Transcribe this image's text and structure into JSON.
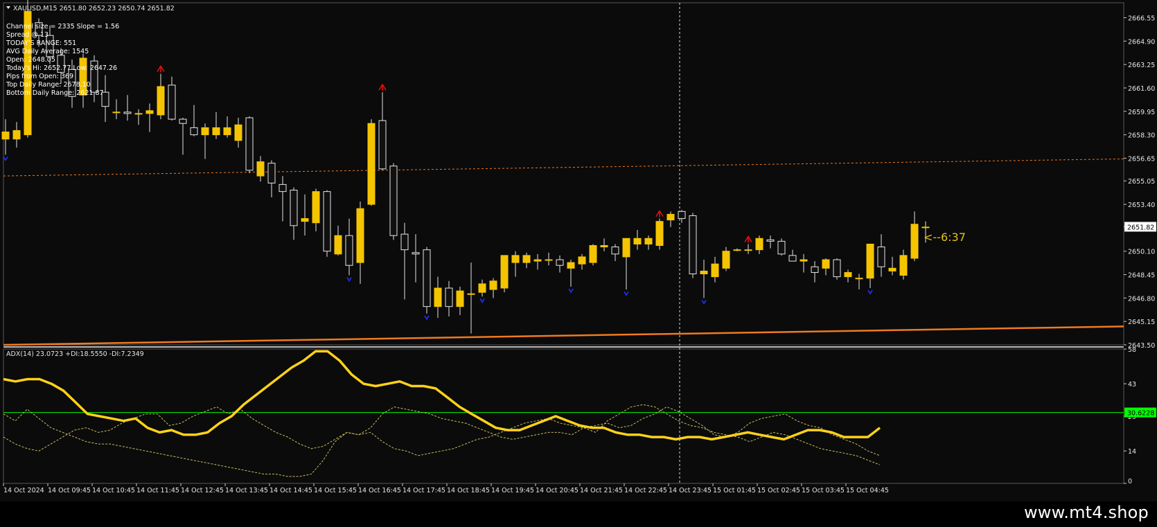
{
  "window": {
    "symbol_header": "XAUUSD,M15  2651.80 2652.23 2650.74 2651.82",
    "brand": "www.mt4.shop"
  },
  "info_lines": [
    "Channel size = 2335 Slope = 1.56",
    "Spread @ 13",
    "TODAY'S RANGE: 551",
    "AVG Daily Average: 1545",
    "Open: 2648.05",
    "Today's Hi: 2652.77  Low: 2647.26",
    "Pips from Open: 369",
    "Top Daily Range: 2678.10",
    "Bottom Daily Range: 2621.87"
  ],
  "countdown": "<--6:37",
  "price_axis": {
    "ticks": [
      "2666.55",
      "2664.90",
      "2663.25",
      "2661.60",
      "2659.95",
      "2658.30",
      "2656.65",
      "2655.05",
      "2653.40",
      "2651.82",
      "2650.10",
      "2648.45",
      "2646.80",
      "2645.15",
      "2643.50"
    ],
    "current_label": "2651.82"
  },
  "adx": {
    "label": "ADX(14) 23.0723 +DI:18.5550 -DI:7.2349",
    "ticks": [
      "58",
      "43",
      "29",
      "14",
      "0"
    ],
    "level_label": "30.6228",
    "level_color": "#00ff00"
  },
  "time_axis": [
    "14 Oct 2024",
    "14 Oct 09:45",
    "14 Oct 10:45",
    "14 Oct 11:45",
    "14 Oct 12:45",
    "14 Oct 13:45",
    "14 Oct 14:45",
    "14 Oct 15:45",
    "14 Oct 16:45",
    "14 Oct 17:45",
    "14 Oct 18:45",
    "14 Oct 19:45",
    "14 Oct 20:45",
    "14 Oct 21:45",
    "14 Oct 22:45",
    "14 Oct 23:45",
    "15 Oct 01:45",
    "15 Oct 02:45",
    "15 Oct 03:45",
    "15 Oct 04:45"
  ],
  "colors": {
    "background": "#0b0b0b",
    "bull_candle": "#f5c400",
    "bear_candle": "#101010",
    "candle_outline": "#e6e6e6",
    "channel": "#f07a20",
    "adx_line": "#ffd21a",
    "di_line": "#c8c060",
    "arrow_up": "#e01010",
    "arrow_down": "#2030ff",
    "countdown": "#e6c21a",
    "axis_text": "#e6e6e6"
  },
  "chart_data": {
    "type": "candlestick",
    "price_range": [
      2643.5,
      2667.6
    ],
    "candles": [
      {
        "o": 2658.0,
        "h": 2659.4,
        "l": 2656.9,
        "c": 2658.5
      },
      {
        "o": 2658.0,
        "h": 2659.2,
        "l": 2657.4,
        "c": 2658.6
      },
      {
        "o": 2658.3,
        "h": 2668.1,
        "l": 2658.1,
        "c": 2667.0
      },
      {
        "o": 2666.2,
        "h": 2666.5,
        "l": 2664.5,
        "c": 2665.3
      },
      {
        "o": 2665.3,
        "h": 2666.0,
        "l": 2663.3,
        "c": 2663.8
      },
      {
        "o": 2663.9,
        "h": 2664.4,
        "l": 2661.9,
        "c": 2662.7
      },
      {
        "o": 2662.9,
        "h": 2663.6,
        "l": 2660.2,
        "c": 2661.0
      },
      {
        "o": 2661.1,
        "h": 2664.0,
        "l": 2660.2,
        "c": 2663.7
      },
      {
        "o": 2663.5,
        "h": 2663.9,
        "l": 2660.6,
        "c": 2661.3
      },
      {
        "o": 2661.3,
        "h": 2662.5,
        "l": 2659.2,
        "c": 2660.3
      },
      {
        "o": 2659.9,
        "h": 2660.8,
        "l": 2659.4,
        "c": 2659.9
      },
      {
        "o": 2659.9,
        "h": 2661.1,
        "l": 2659.3,
        "c": 2659.8
      },
      {
        "o": 2659.8,
        "h": 2660.1,
        "l": 2659.0,
        "c": 2659.8
      },
      {
        "o": 2659.8,
        "h": 2660.5,
        "l": 2658.5,
        "c": 2660.0
      },
      {
        "o": 2659.7,
        "h": 2662.6,
        "l": 2659.4,
        "c": 2661.7
      },
      {
        "o": 2661.8,
        "h": 2662.4,
        "l": 2659.3,
        "c": 2659.4
      },
      {
        "o": 2659.4,
        "h": 2659.5,
        "l": 2656.9,
        "c": 2659.1
      },
      {
        "o": 2658.8,
        "h": 2660.4,
        "l": 2658.2,
        "c": 2658.3
      },
      {
        "o": 2658.3,
        "h": 2659.1,
        "l": 2656.6,
        "c": 2658.8
      },
      {
        "o": 2658.3,
        "h": 2659.9,
        "l": 2658.0,
        "c": 2658.8
      },
      {
        "o": 2658.3,
        "h": 2659.6,
        "l": 2658.1,
        "c": 2658.8
      },
      {
        "o": 2657.9,
        "h": 2659.5,
        "l": 2657.4,
        "c": 2659.0
      },
      {
        "o": 2659.5,
        "h": 2659.6,
        "l": 2655.6,
        "c": 2655.8
      },
      {
        "o": 2655.4,
        "h": 2656.8,
        "l": 2655.0,
        "c": 2656.4
      },
      {
        "o": 2656.3,
        "h": 2656.5,
        "l": 2653.9,
        "c": 2654.9
      },
      {
        "o": 2654.8,
        "h": 2655.4,
        "l": 2652.2,
        "c": 2654.3
      },
      {
        "o": 2654.4,
        "h": 2654.6,
        "l": 2650.9,
        "c": 2651.9
      },
      {
        "o": 2652.2,
        "h": 2654.1,
        "l": 2651.2,
        "c": 2652.4
      },
      {
        "o": 2652.1,
        "h": 2654.5,
        "l": 2651.5,
        "c": 2654.3
      },
      {
        "o": 2654.3,
        "h": 2654.4,
        "l": 2649.7,
        "c": 2650.1
      },
      {
        "o": 2649.9,
        "h": 2651.9,
        "l": 2649.8,
        "c": 2651.2
      },
      {
        "o": 2651.2,
        "h": 2652.4,
        "l": 2648.4,
        "c": 2649.1
      },
      {
        "o": 2649.3,
        "h": 2653.6,
        "l": 2647.8,
        "c": 2653.1
      },
      {
        "o": 2653.4,
        "h": 2659.4,
        "l": 2653.3,
        "c": 2659.1
      },
      {
        "o": 2659.3,
        "h": 2661.3,
        "l": 2655.8,
        "c": 2655.9
      },
      {
        "o": 2656.1,
        "h": 2656.3,
        "l": 2650.9,
        "c": 2651.2
      },
      {
        "o": 2651.3,
        "h": 2652.1,
        "l": 2646.7,
        "c": 2650.2
      },
      {
        "o": 2650.0,
        "h": 2651.3,
        "l": 2647.9,
        "c": 2649.9
      },
      {
        "o": 2650.2,
        "h": 2650.4,
        "l": 2645.7,
        "c": 2646.2
      },
      {
        "o": 2646.2,
        "h": 2648.3,
        "l": 2645.4,
        "c": 2647.5
      },
      {
        "o": 2647.5,
        "h": 2648.0,
        "l": 2645.5,
        "c": 2646.2
      },
      {
        "o": 2646.2,
        "h": 2647.6,
        "l": 2645.6,
        "c": 2647.3
      },
      {
        "o": 2647.1,
        "h": 2649.3,
        "l": 2644.3,
        "c": 2647.1
      },
      {
        "o": 2647.2,
        "h": 2648.1,
        "l": 2646.9,
        "c": 2647.8
      },
      {
        "o": 2647.4,
        "h": 2648.2,
        "l": 2646.8,
        "c": 2648.0
      },
      {
        "o": 2647.5,
        "h": 2649.1,
        "l": 2647.2,
        "c": 2649.8
      },
      {
        "o": 2649.3,
        "h": 2650.1,
        "l": 2648.3,
        "c": 2649.8
      },
      {
        "o": 2649.3,
        "h": 2650.0,
        "l": 2648.9,
        "c": 2649.8
      },
      {
        "o": 2649.4,
        "h": 2649.9,
        "l": 2648.8,
        "c": 2649.5
      },
      {
        "o": 2649.5,
        "h": 2650.0,
        "l": 2649.1,
        "c": 2649.5
      },
      {
        "o": 2649.5,
        "h": 2649.8,
        "l": 2648.6,
        "c": 2649.1
      },
      {
        "o": 2648.9,
        "h": 2649.5,
        "l": 2647.6,
        "c": 2649.3
      },
      {
        "o": 2649.2,
        "h": 2649.9,
        "l": 2648.8,
        "c": 2649.7
      },
      {
        "o": 2649.3,
        "h": 2650.6,
        "l": 2649.1,
        "c": 2650.5
      },
      {
        "o": 2650.4,
        "h": 2651.0,
        "l": 2650.1,
        "c": 2650.5
      },
      {
        "o": 2650.4,
        "h": 2650.6,
        "l": 2649.4,
        "c": 2649.9
      },
      {
        "o": 2649.7,
        "h": 2650.7,
        "l": 2647.4,
        "c": 2651.0
      },
      {
        "o": 2650.6,
        "h": 2651.6,
        "l": 2650.2,
        "c": 2651.0
      },
      {
        "o": 2650.6,
        "h": 2651.2,
        "l": 2650.2,
        "c": 2651.0
      },
      {
        "o": 2650.5,
        "h": 2652.4,
        "l": 2650.2,
        "c": 2652.2
      },
      {
        "o": 2652.3,
        "h": 2652.9,
        "l": 2651.8,
        "c": 2652.7
      },
      {
        "o": 2652.9,
        "h": 2653.0,
        "l": 2652.1,
        "c": 2652.4
      },
      {
        "o": 2652.6,
        "h": 2652.8,
        "l": 2648.2,
        "c": 2648.5
      },
      {
        "o": 2648.5,
        "h": 2649.5,
        "l": 2646.8,
        "c": 2648.7
      },
      {
        "o": 2648.3,
        "h": 2649.7,
        "l": 2647.9,
        "c": 2649.2
      },
      {
        "o": 2648.9,
        "h": 2650.4,
        "l": 2648.7,
        "c": 2650.1
      },
      {
        "o": 2650.2,
        "h": 2650.3,
        "l": 2650.1,
        "c": 2650.2
      },
      {
        "o": 2650.2,
        "h": 2650.6,
        "l": 2649.9,
        "c": 2650.2
      },
      {
        "o": 2650.2,
        "h": 2651.2,
        "l": 2649.9,
        "c": 2651.0
      },
      {
        "o": 2650.9,
        "h": 2651.2,
        "l": 2650.3,
        "c": 2650.8
      },
      {
        "o": 2650.8,
        "h": 2651.0,
        "l": 2649.8,
        "c": 2649.9
      },
      {
        "o": 2649.8,
        "h": 2650.2,
        "l": 2649.4,
        "c": 2649.4
      },
      {
        "o": 2649.4,
        "h": 2649.9,
        "l": 2648.6,
        "c": 2649.5
      },
      {
        "o": 2649.0,
        "h": 2649.4,
        "l": 2647.9,
        "c": 2648.6
      },
      {
        "o": 2648.9,
        "h": 2649.6,
        "l": 2648.4,
        "c": 2649.5
      },
      {
        "o": 2649.5,
        "h": 2649.6,
        "l": 2648.1,
        "c": 2648.3
      },
      {
        "o": 2648.3,
        "h": 2648.8,
        "l": 2647.9,
        "c": 2648.6
      },
      {
        "o": 2648.2,
        "h": 2648.5,
        "l": 2647.4,
        "c": 2648.2
      },
      {
        "o": 2648.2,
        "h": 2650.3,
        "l": 2647.5,
        "c": 2650.6
      },
      {
        "o": 2650.4,
        "h": 2651.3,
        "l": 2648.3,
        "c": 2649.0
      },
      {
        "o": 2648.7,
        "h": 2649.7,
        "l": 2648.4,
        "c": 2648.9
      },
      {
        "o": 2648.4,
        "h": 2650.2,
        "l": 2648.1,
        "c": 2649.8
      },
      {
        "o": 2649.6,
        "h": 2652.9,
        "l": 2649.4,
        "c": 2652.0
      },
      {
        "o": 2651.8,
        "h": 2652.2,
        "l": 2650.7,
        "c": 2651.8
      }
    ],
    "channel": {
      "upper": [
        2668.1,
        2667.8
      ],
      "middle": [
        2655.4,
        2656.6
      ],
      "lower": [
        2643.5,
        2644.8
      ]
    },
    "arrows_up": [
      2,
      14,
      34,
      59,
      67
    ],
    "arrows_down": [
      0,
      31,
      38,
      43,
      51,
      56,
      63,
      78
    ],
    "adx_range": [
      0,
      58
    ],
    "adx_level": 30.6228,
    "adx_series": [
      45,
      44,
      45,
      45,
      43,
      40,
      35,
      30,
      29,
      28,
      27,
      28,
      24,
      22,
      23,
      21,
      21,
      22,
      26,
      29,
      34,
      38,
      42,
      46,
      50,
      53,
      57,
      57,
      53,
      47,
      43,
      42,
      43,
      44,
      42,
      42,
      41,
      37,
      33,
      30,
      27,
      24,
      23,
      23,
      25,
      27,
      29,
      27,
      25,
      24,
      24,
      22,
      21,
      21,
      20,
      20,
      19,
      20,
      20,
      19,
      20,
      21,
      22,
      21,
      20,
      19,
      21,
      23,
      23,
      22,
      20,
      20,
      20,
      24
    ],
    "plus_di": [
      30,
      27,
      32,
      28,
      24,
      22,
      20,
      18,
      17,
      17,
      16,
      15,
      14,
      13,
      12,
      11,
      10,
      9,
      8,
      7,
      6,
      5,
      4,
      4,
      3,
      3,
      4,
      10,
      18,
      22,
      21,
      24,
      30,
      33,
      32,
      31,
      30,
      28,
      27,
      26,
      24,
      22,
      20,
      19,
      20,
      21,
      22,
      22,
      21,
      24,
      25,
      26,
      24,
      25,
      28,
      30,
      33,
      31,
      28,
      25,
      21,
      20,
      22,
      26,
      28,
      29,
      30,
      27,
      25,
      24,
      21,
      19,
      17,
      14,
      12
    ],
    "minus_di": [
      20,
      17,
      15,
      14,
      17,
      20,
      23,
      24,
      22,
      23,
      26,
      28,
      30,
      30,
      25,
      26,
      29,
      31,
      33,
      30,
      32,
      28,
      25,
      22,
      20,
      17,
      15,
      16,
      19,
      22,
      21,
      22,
      18,
      15,
      14,
      12,
      13,
      14,
      15,
      17,
      19,
      20,
      22,
      24,
      26,
      27,
      28,
      26,
      25,
      24,
      22,
      27,
      30,
      33,
      34,
      33,
      30,
      27,
      25,
      24,
      22,
      21,
      20,
      18,
      20,
      22,
      21,
      19,
      17,
      15,
      14,
      13,
      12,
      10,
      8
    ]
  }
}
